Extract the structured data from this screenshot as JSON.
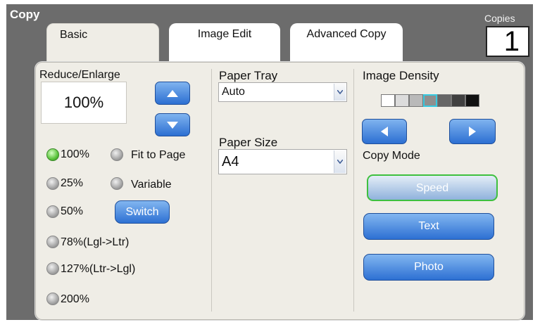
{
  "window": {
    "title": "Copy"
  },
  "tabs": [
    {
      "label": "Basic"
    },
    {
      "label": "Image Edit"
    },
    {
      "label": "Advanced Copy"
    }
  ],
  "copies": {
    "label": "Copies",
    "value": "1"
  },
  "reduce_enlarge": {
    "label": "Reduce/Enlarge",
    "value": "100%",
    "options": [
      {
        "label": "100%",
        "selected": true
      },
      {
        "label": "25%",
        "selected": false
      },
      {
        "label": "50%",
        "selected": false
      },
      {
        "label": "78%(Lgl->Ltr)",
        "selected": false
      },
      {
        "label": "127%(Ltr->Lgl)",
        "selected": false
      },
      {
        "label": "200%",
        "selected": false
      },
      {
        "label": "Fit to Page",
        "selected": false
      },
      {
        "label": "Variable",
        "selected": false
      }
    ],
    "switch_label": "Switch"
  },
  "paper_tray": {
    "label": "Paper Tray",
    "value": "Auto"
  },
  "paper_size": {
    "label": "Paper Size",
    "value": "A4"
  },
  "image_density": {
    "label": "Image Density",
    "levels": 7,
    "selected_level": 4,
    "colors": [
      "#ffffff",
      "#dcdcdc",
      "#b9b9b9",
      "#8f8f8f",
      "#666666",
      "#404040",
      "#111111"
    ],
    "highlight": "#37c9e0"
  },
  "copy_mode": {
    "label": "Copy Mode",
    "modes": [
      {
        "label": "Speed",
        "selected": true
      },
      {
        "label": "Text",
        "selected": false
      },
      {
        "label": "Photo",
        "selected": false
      }
    ]
  }
}
